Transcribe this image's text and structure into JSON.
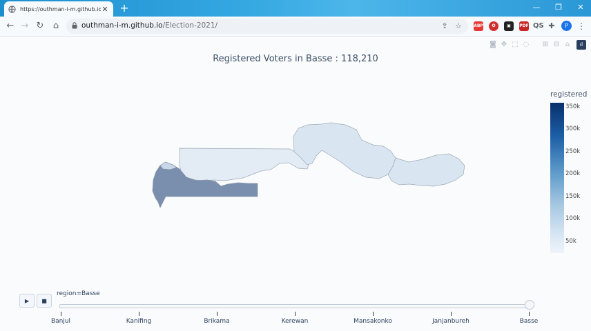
{
  "browser": {
    "tab_title": "https://outhman-i-m.github.io/Elec",
    "new_tab_label": "+",
    "url_host": "outhman-i-m.github.io",
    "url_path": "/Election-2021/",
    "profile_initial": "P"
  },
  "plot": {
    "title": "Registered Voters in Basse : 118,210",
    "colorbar_title": "registered",
    "colorbar_ticks": [
      "350k",
      "300k",
      "250k",
      "200k",
      "150k",
      "100k",
      "50k"
    ],
    "colorscale": [
      "#08306b",
      "#1c5ea6",
      "#5a98c8",
      "#a6c7e2",
      "#d8e6f3",
      "#eef4fa"
    ],
    "region_colors": {
      "west": "#7a8fad",
      "central_strip": "#e3ebf4",
      "east": "#d9e5f1"
    }
  },
  "slider": {
    "current_label": "region=Basse",
    "play_icon": "▶",
    "stop_icon": "■",
    "steps": [
      "Banjul",
      "Kanifing",
      "Brikama",
      "Kerewan",
      "Mansakonko",
      "Janjanbureh",
      "Basse"
    ],
    "active_step": "Basse"
  }
}
